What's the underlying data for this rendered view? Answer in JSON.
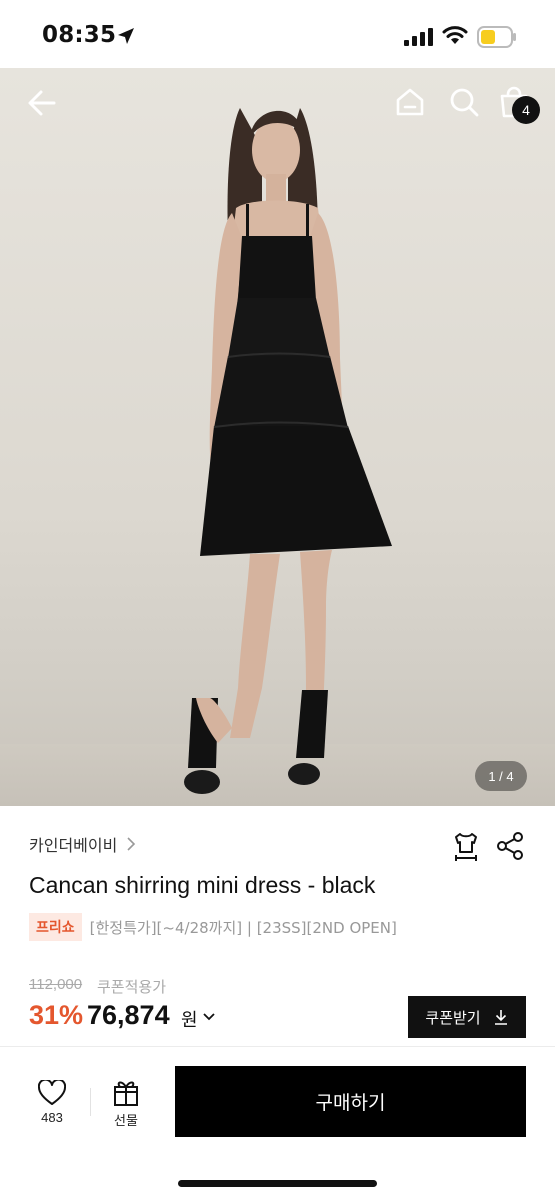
{
  "status_bar": {
    "time": "08:35"
  },
  "hero": {
    "cart_count": "4",
    "page_indicator": "1 / 4",
    "background": "#e2dfd8",
    "dress_color": "#121212"
  },
  "product": {
    "brand": "카인더베이비",
    "title": "Cancan shirring mini dress - black",
    "preshow_badge": "프리쇼",
    "tags": "[한정특가][~4/28까지] | [23SS][2ND OPEN]",
    "original_price": "112,000",
    "coupon_applied_label": "쿠폰적용가",
    "discount_rate": "31%",
    "current_price": "76,874",
    "price_unit": "원",
    "coupon_button_label": "쿠폰받기",
    "accent_color": "#e4572e"
  },
  "bottom_bar": {
    "like_count": "483",
    "gift_label": "선물",
    "buy_label": "구매하기"
  },
  "icons": {
    "location": "location-arrow-icon",
    "signal": "cellular-signal-icon",
    "wifi": "wifi-icon",
    "battery": "battery-low-icon",
    "back": "back-arrow-icon",
    "home": "home-icon",
    "search": "search-icon",
    "cart": "shopping-bag-icon",
    "size": "size-chart-icon",
    "share": "share-icon",
    "like": "heart-icon",
    "gift": "gift-icon",
    "download": "download-icon"
  }
}
